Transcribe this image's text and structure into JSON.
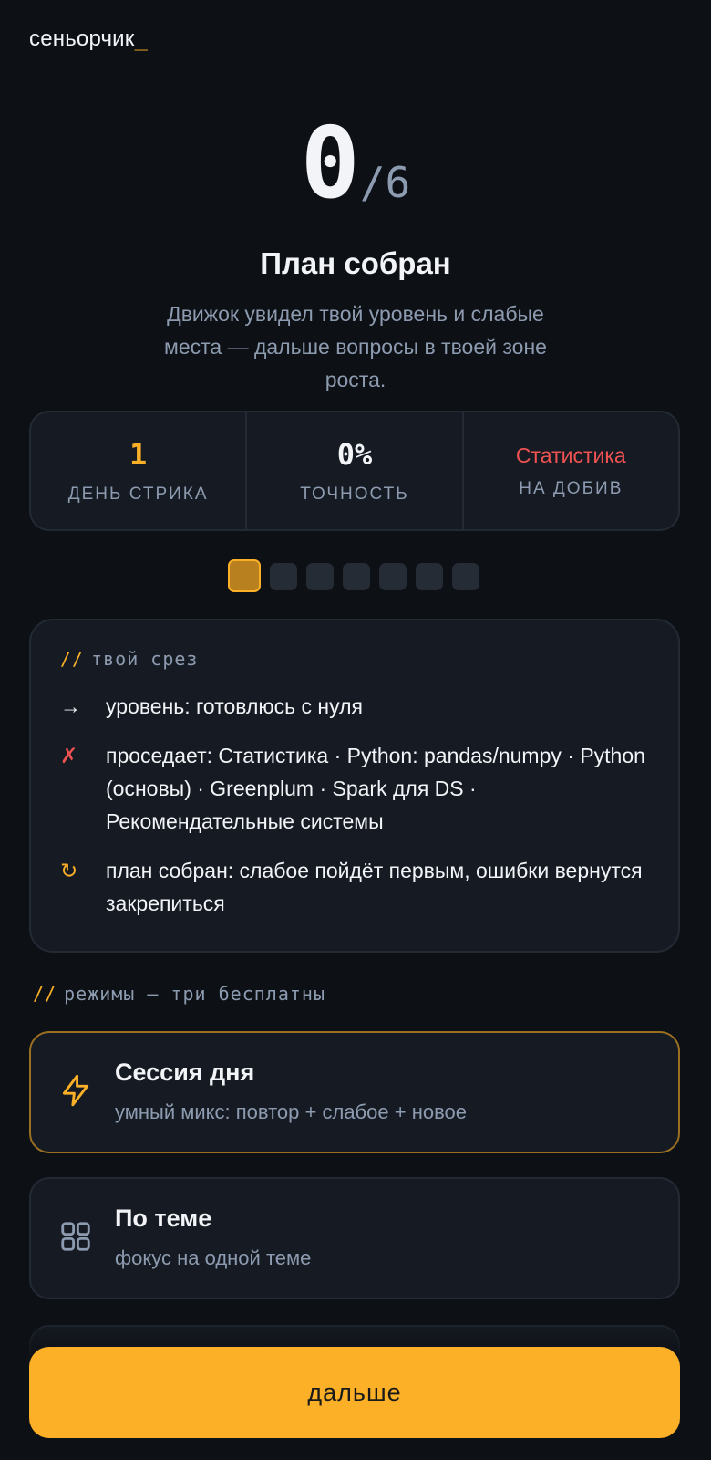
{
  "app": {
    "logo_text": "сеньорчик",
    "logo_cursor": "_"
  },
  "result": {
    "score": "0",
    "total": "/6",
    "title": "План собран",
    "subtitle": "Движок увидел твой уровень и слабые места — дальше вопросы в твоей зоне роста."
  },
  "stats": [
    {
      "value": "1",
      "label": "ДЕНЬ СТРИКА"
    },
    {
      "value": "0%",
      "label": "ТОЧНОСТЬ"
    },
    {
      "value": "Статистика",
      "label": "НА ДОБИВ"
    }
  ],
  "progress_dots": {
    "total": 7,
    "active_index": 0
  },
  "slice": {
    "slashes": "//",
    "heading": "твой срез",
    "items": [
      {
        "marker": "→",
        "text": "уровень: готовлюсь с нуля"
      },
      {
        "marker": "✗",
        "text": "проседает: Статистика · Python: pandas/numpy · Python (основы) · Greenplum · Spark для DS · Рекомендательные системы"
      },
      {
        "marker": "↻",
        "text": "план собран: слабое пойдёт первым, ошибки вернутся закрепиться"
      }
    ]
  },
  "modes": {
    "slashes": "//",
    "heading": "режимы — три бесплатны",
    "items": [
      {
        "title": "Сессия дня",
        "description": "умный микс: повтор + слабое + новое",
        "icon": "lightning-icon",
        "selected": true
      },
      {
        "title": "По теме",
        "description": "фокус на одной теме",
        "icon": "grid-icon",
        "selected": false
      }
    ]
  },
  "cta": {
    "label": "дальше"
  },
  "colors": {
    "background": "#0d1015",
    "card": "#161b23",
    "accent": "#fbb027",
    "danger": "#f05252",
    "muted": "#8d9bb0"
  }
}
